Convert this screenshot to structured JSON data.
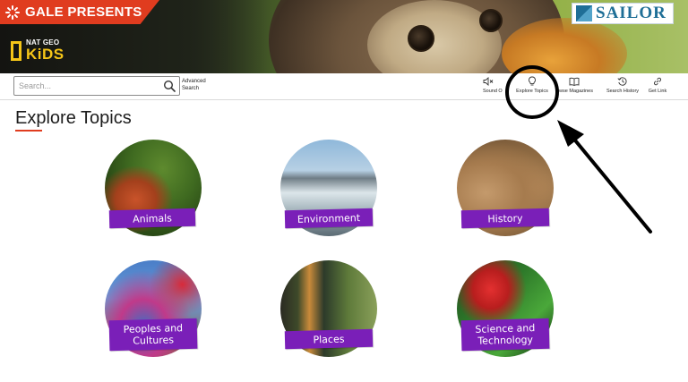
{
  "header": {
    "gale_label": "GALE PRESENTS",
    "brand_top": "NAT GEO",
    "brand_kids": "KiDS",
    "partner_label": "SAILOR"
  },
  "toolbar": {
    "search_placeholder": "Search...",
    "advanced_search": "Advanced Search",
    "tools": {
      "sound": "Sound O",
      "explore": "Explore Topics",
      "browse": "owse Magazines",
      "history": "Search History",
      "link": "Get Link"
    }
  },
  "main": {
    "title": "Explore Topics",
    "topics": [
      {
        "label": "Animals"
      },
      {
        "label": "Environment"
      },
      {
        "label": "History"
      },
      {
        "label": "Peoples and Cultures"
      },
      {
        "label": "Places"
      },
      {
        "label": "Science and Technology"
      }
    ]
  },
  "colors": {
    "accent_red": "#e03c1f",
    "tag_purple": "#7a1fb8",
    "natgeo_yellow": "#f5c518",
    "sailor_blue": "#1f6f97"
  },
  "icons": {
    "search": "search-icon",
    "sound": "speaker-mute-icon",
    "explore": "lightbulb-icon",
    "browse": "open-book-icon",
    "history": "history-clock-icon",
    "link": "link-icon"
  }
}
